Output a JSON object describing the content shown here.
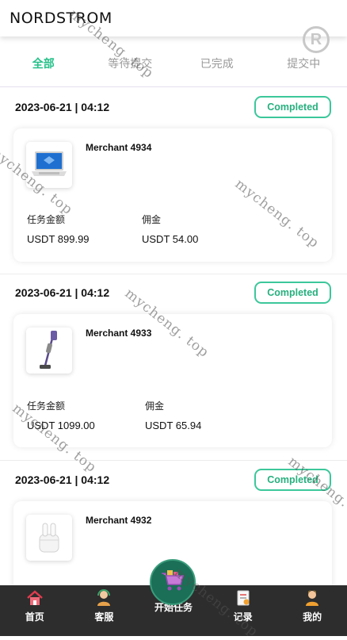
{
  "header": {
    "logo": "NORDSTROM",
    "reg_mark": "R"
  },
  "tabs": [
    {
      "label": "全部",
      "active": true
    },
    {
      "label": "等待提交",
      "active": false
    },
    {
      "label": "已完成",
      "active": false
    },
    {
      "label": "提交中",
      "active": false
    }
  ],
  "orders": [
    {
      "datetime": "2023-06-21 | 04:12",
      "status": "Completed",
      "merchant": "Merchant 4934",
      "product_icon": "laptop-icon",
      "amount_label": "任务金额",
      "amount": "USDT 899.99",
      "commission_label": "佣金",
      "commission": "USDT 54.00"
    },
    {
      "datetime": "2023-06-21 | 04:12",
      "status": "Completed",
      "merchant": "Merchant 4933",
      "product_icon": "vacuum-icon",
      "amount_label": "任务金额",
      "amount": "USDT 1099.00",
      "commission_label": "佣金",
      "commission": "USDT 65.94"
    },
    {
      "datetime": "2023-06-21 | 04:12",
      "status": "Completed",
      "merchant": "Merchant 4932",
      "product_icon": "earbuds-icon"
    }
  ],
  "nav": [
    {
      "label": "首页",
      "icon": "home-icon"
    },
    {
      "label": "客服",
      "icon": "support-agent-icon"
    },
    {
      "label": "开始任务",
      "icon": "cart-icon"
    },
    {
      "label": "记录",
      "icon": "records-icon"
    },
    {
      "label": "我的",
      "icon": "profile-icon"
    }
  ],
  "watermark": "mycheng. top",
  "colors": {
    "accent": "#27c08a",
    "nav_bg": "#2d2d2d",
    "center_button": "#1a6f56"
  }
}
